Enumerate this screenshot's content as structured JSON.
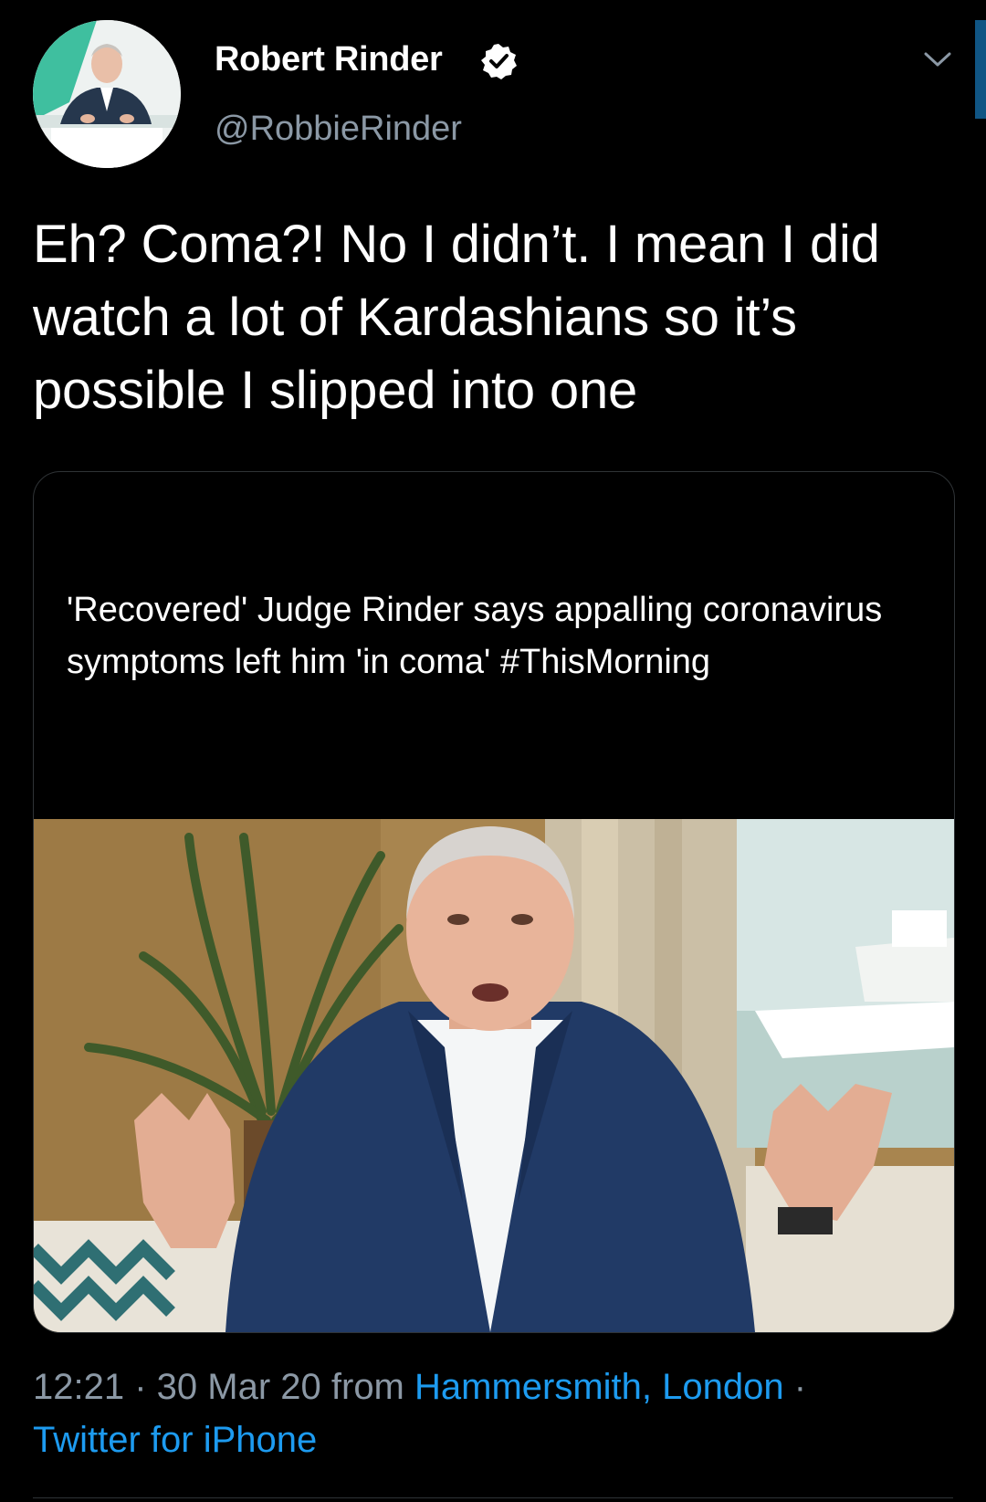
{
  "author": {
    "name": "Robert Rinder",
    "handle": "@RobbieRinder",
    "verified_icon": "verified-badge-icon",
    "menu_icon": "chevron-down-icon"
  },
  "tweet": {
    "text": "Eh? Coma?! No I didn’t. I mean I did watch a lot of Kardashians so it’s possible I slipped into one"
  },
  "card": {
    "text": "'Recovered' Judge Rinder says appalling coronavirus symptoms left him 'in coma' #ThisMorning"
  },
  "meta": {
    "time": "12:21",
    "separator": " · ",
    "date": "30 Mar 20",
    "from_label": " from ",
    "location": "Hammersmith, London",
    "separator2": " · ",
    "source": "Twitter for iPhone"
  },
  "colors": {
    "background": "#000000",
    "link": "#1d9bf0",
    "secondary_text": "#8b98a5",
    "primary_text": "#ffffff"
  }
}
